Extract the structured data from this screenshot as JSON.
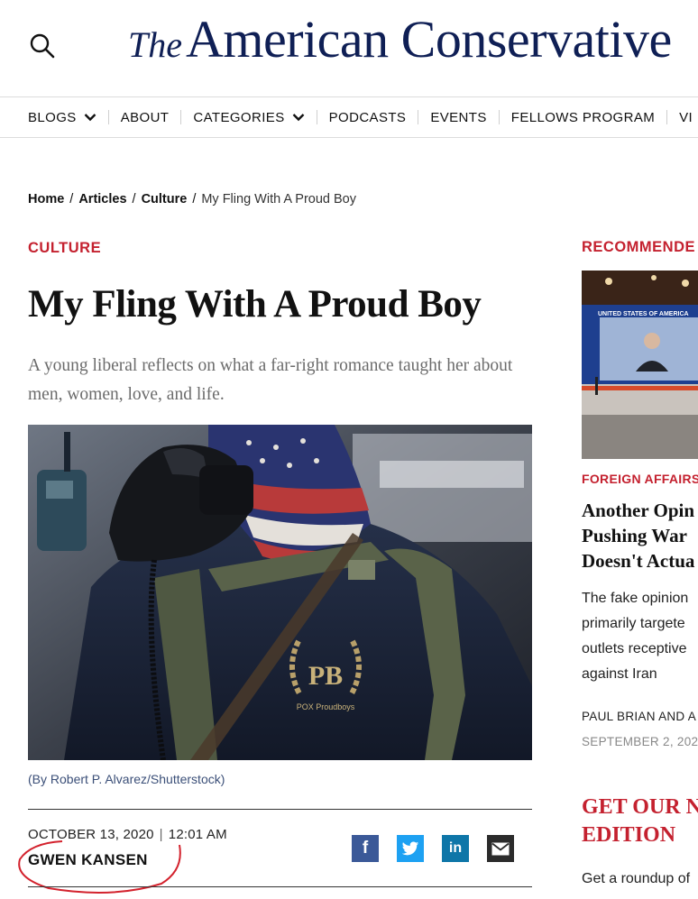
{
  "header": {
    "logo_the": "The",
    "logo_main": "American Conservative"
  },
  "nav": {
    "items": [
      {
        "label": "BLOGS",
        "dropdown": true
      },
      {
        "label": "ABOUT"
      },
      {
        "label": "CATEGORIES",
        "dropdown": true
      },
      {
        "label": "PODCASTS"
      },
      {
        "label": "EVENTS"
      },
      {
        "label": "FELLOWS PROGRAM"
      },
      {
        "label": "VI"
      }
    ]
  },
  "breadcrumb": {
    "home": "Home",
    "articles": "Articles",
    "culture": "Culture",
    "current": "My Fling With A Proud Boy",
    "separator": "/"
  },
  "article": {
    "category": "CULTURE",
    "title": "My Fling With A Proud Boy",
    "dek": "A young liberal reflects on what a far-right romance taught her about men, women, love, and life.",
    "image_caption": "(By Robert P. Alvarez/Shutterstock)",
    "image_shirt_text": "PB",
    "image_shirt_subtext": "POX Proudboys",
    "date": "OCTOBER 13, 2020",
    "time": "12:01 AM",
    "date_separator": "|",
    "author": "GWEN KANSEN"
  },
  "share": {
    "facebook_glyph": "f",
    "linkedin_glyph": "in",
    "colors": {
      "facebook": "#3b5998",
      "twitter": "#1da1f2",
      "linkedin": "#0e76a8",
      "email": "#2b2b2b"
    }
  },
  "sidebar": {
    "heading": "RECOMMENDE",
    "image_banner": "UNITED STATES OF AMERICA",
    "category": "FOREIGN AFFAIRS",
    "title_lines": [
      "Another Opin",
      "Pushing War",
      "Doesn't Actua"
    ],
    "excerpt_lines": [
      "The fake opinion",
      "primarily targete",
      "outlets receptive",
      "against Iran"
    ],
    "author": "PAUL BRIAN AND A",
    "date": "SEPTEMBER 2, 202",
    "promo_lines": [
      "GET OUR N",
      "EDITION"
    ],
    "promo_text": "Get a roundup of"
  },
  "colors": {
    "accent_red": "#c4212f",
    "logo_navy": "#0f1f55",
    "caption_blue": "#3b4f78"
  }
}
